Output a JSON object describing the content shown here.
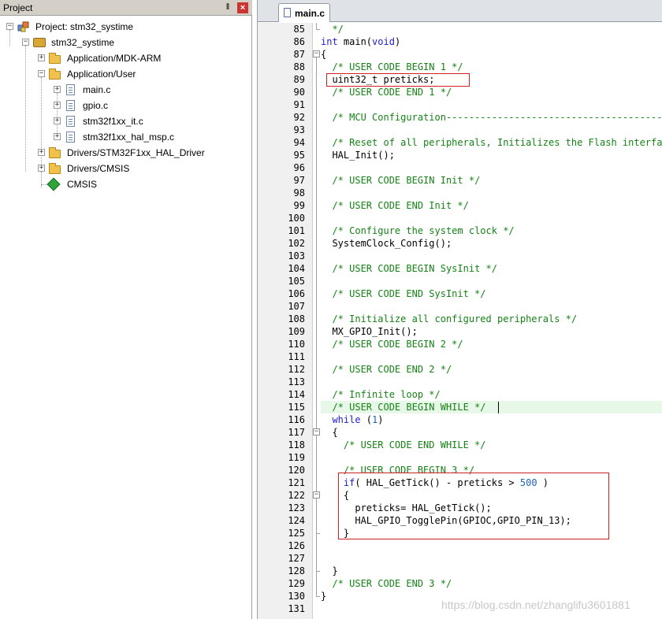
{
  "project_pane": {
    "title": "Project",
    "pin_glyph": "‖",
    "close_glyph": "×",
    "tree": [
      {
        "label": "Project: stm32_systime",
        "icon": "project-icon"
      },
      {
        "label": "stm32_systime",
        "icon": "target-icon"
      },
      {
        "label": "Application/MDK-ARM",
        "icon": "folder-icon"
      },
      {
        "label": "Application/User",
        "icon": "folder-open-icon"
      },
      {
        "label": "main.c",
        "icon": "file-icon"
      },
      {
        "label": "gpio.c",
        "icon": "file-icon"
      },
      {
        "label": "stm32f1xx_it.c",
        "icon": "file-icon"
      },
      {
        "label": "stm32f1xx_hal_msp.c",
        "icon": "file-icon"
      },
      {
        "label": "Drivers/STM32F1xx_HAL_Driver",
        "icon": "folder-icon"
      },
      {
        "label": "Drivers/CMSIS",
        "icon": "folder-icon"
      },
      {
        "label": "CMSIS",
        "icon": "cmsis-icon"
      }
    ]
  },
  "editor": {
    "tab_label": "main.c",
    "lines": [
      {
        "num": "85",
        "segments": [
          {
            "t": "  */",
            "c": "comment"
          }
        ]
      },
      {
        "num": "86",
        "segments": [
          {
            "t": "int",
            "c": "keyword"
          },
          {
            "t": " main(",
            "c": "plain"
          },
          {
            "t": "void",
            "c": "keyword"
          },
          {
            "t": ")",
            "c": "plain"
          }
        ]
      },
      {
        "num": "87",
        "segments": [
          {
            "t": "{",
            "c": "plain"
          }
        ]
      },
      {
        "num": "88",
        "segments": [
          {
            "t": "  /* USER CODE BEGIN 1 */",
            "c": "comment"
          }
        ]
      },
      {
        "num": "89",
        "segments": [
          {
            "t": "  uint32_t preticks;",
            "c": "plain"
          }
        ]
      },
      {
        "num": "90",
        "segments": [
          {
            "t": "  /* USER CODE END 1 */",
            "c": "comment"
          }
        ]
      },
      {
        "num": "91",
        "segments": []
      },
      {
        "num": "92",
        "segments": [
          {
            "t": "  /* MCU Configuration-----------------------------------------------",
            "c": "comment"
          }
        ]
      },
      {
        "num": "93",
        "segments": []
      },
      {
        "num": "94",
        "segments": [
          {
            "t": "  /* Reset of all peripherals, Initializes the Flash interface",
            "c": "comment"
          }
        ]
      },
      {
        "num": "95",
        "segments": [
          {
            "t": "  HAL_Init();",
            "c": "plain"
          }
        ]
      },
      {
        "num": "96",
        "segments": []
      },
      {
        "num": "97",
        "segments": [
          {
            "t": "  /* USER CODE BEGIN Init */",
            "c": "comment"
          }
        ]
      },
      {
        "num": "98",
        "segments": []
      },
      {
        "num": "99",
        "segments": [
          {
            "t": "  /* USER CODE END Init */",
            "c": "comment"
          }
        ]
      },
      {
        "num": "100",
        "segments": []
      },
      {
        "num": "101",
        "segments": [
          {
            "t": "  /* Configure the system clock */",
            "c": "comment"
          }
        ]
      },
      {
        "num": "102",
        "segments": [
          {
            "t": "  SystemClock_Config();",
            "c": "plain"
          }
        ]
      },
      {
        "num": "103",
        "segments": []
      },
      {
        "num": "104",
        "segments": [
          {
            "t": "  /* USER CODE BEGIN SysInit */",
            "c": "comment"
          }
        ]
      },
      {
        "num": "105",
        "segments": []
      },
      {
        "num": "106",
        "segments": [
          {
            "t": "  /* USER CODE END SysInit */",
            "c": "comment"
          }
        ]
      },
      {
        "num": "107",
        "segments": []
      },
      {
        "num": "108",
        "segments": [
          {
            "t": "  /* Initialize all configured peripherals */",
            "c": "comment"
          }
        ]
      },
      {
        "num": "109",
        "segments": [
          {
            "t": "  MX_GPIO_Init();",
            "c": "plain"
          }
        ]
      },
      {
        "num": "110",
        "segments": [
          {
            "t": "  /* USER CODE BEGIN 2 */",
            "c": "comment"
          }
        ]
      },
      {
        "num": "111",
        "segments": []
      },
      {
        "num": "112",
        "segments": [
          {
            "t": "  /* USER CODE END 2 */",
            "c": "comment"
          }
        ]
      },
      {
        "num": "113",
        "segments": []
      },
      {
        "num": "114",
        "segments": [
          {
            "t": "  /* Infinite loop */",
            "c": "comment"
          }
        ]
      },
      {
        "num": "115",
        "segments": [
          {
            "t": "  /* USER CODE BEGIN WHILE */",
            "c": "comment"
          }
        ]
      },
      {
        "num": "116",
        "segments": [
          {
            "t": "  ",
            "c": "plain"
          },
          {
            "t": "while",
            "c": "keyword"
          },
          {
            "t": " (",
            "c": "plain"
          },
          {
            "t": "1",
            "c": "number"
          },
          {
            "t": ")",
            "c": "plain"
          }
        ]
      },
      {
        "num": "117",
        "segments": [
          {
            "t": "  {",
            "c": "plain"
          }
        ]
      },
      {
        "num": "118",
        "segments": [
          {
            "t": "    /* USER CODE END WHILE */",
            "c": "comment"
          }
        ]
      },
      {
        "num": "119",
        "segments": []
      },
      {
        "num": "120",
        "segments": [
          {
            "t": "    /* USER CODE BEGIN 3 */",
            "c": "comment"
          }
        ]
      },
      {
        "num": "121",
        "segments": [
          {
            "t": "    ",
            "c": "plain"
          },
          {
            "t": "if",
            "c": "keyword"
          },
          {
            "t": "( HAL_GetTick() - preticks > ",
            "c": "plain"
          },
          {
            "t": "500",
            "c": "number"
          },
          {
            "t": " )",
            "c": "plain"
          }
        ]
      },
      {
        "num": "122",
        "segments": [
          {
            "t": "    {",
            "c": "plain"
          }
        ]
      },
      {
        "num": "123",
        "segments": [
          {
            "t": "      preticks= HAL_GetTick();",
            "c": "plain"
          }
        ]
      },
      {
        "num": "124",
        "segments": [
          {
            "t": "      HAL_GPIO_TogglePin(GPIOC,GPIO_PIN_13);",
            "c": "plain"
          }
        ]
      },
      {
        "num": "125",
        "segments": [
          {
            "t": "    }",
            "c": "plain"
          }
        ]
      },
      {
        "num": "126",
        "segments": []
      },
      {
        "num": "127",
        "segments": []
      },
      {
        "num": "128",
        "segments": [
          {
            "t": "  }",
            "c": "plain"
          }
        ]
      },
      {
        "num": "129",
        "segments": [
          {
            "t": "  /* USER CODE END 3 */",
            "c": "comment"
          }
        ]
      },
      {
        "num": "130",
        "segments": [
          {
            "t": "}",
            "c": "plain"
          }
        ]
      },
      {
        "num": "131",
        "segments": []
      }
    ],
    "current_line": "115",
    "colors": {
      "comment": "#168216",
      "keyword": "#1d1dd6",
      "number": "#1d63b8",
      "highlight_box": "#d02020",
      "current_line_bg": "#e8f8e8"
    }
  },
  "watermark": "https://blog.csdn.net/zhanglifu3601881"
}
